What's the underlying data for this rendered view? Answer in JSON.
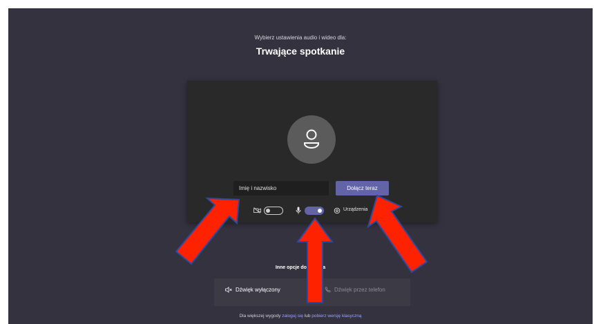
{
  "header": {
    "subtitle": "Wybierz ustawienia audio i wideo dla:",
    "title": "Trwające spotkanie"
  },
  "preview": {
    "avatar_icon": "person-icon",
    "name_placeholder": "Imię i nazwisko",
    "join_label": "Dołącz teraz"
  },
  "controls": {
    "camera": {
      "icon": "camera-off-icon",
      "on": false
    },
    "mic": {
      "icon": "microphone-icon",
      "on": true
    },
    "devices_icon": "gear-icon",
    "devices_label": "Urządzenia"
  },
  "other_options": {
    "heading": "Inne opcje dołączania",
    "audio_off_label": "Dźwięk wyłączony",
    "phone_audio_label": "Dźwięk przez telefon"
  },
  "footer": {
    "prefix": "Dla większej wygody",
    "login_link": "zaloguj się",
    "middle": "lub",
    "download_link": "pobierz wersję klasyczną"
  },
  "colors": {
    "background": "#34323f",
    "accent": "#6264a7",
    "arrow_fill": "#ff2200",
    "arrow_stroke": "#2b4aa0"
  },
  "annotations": {
    "arrow_count": 3
  }
}
